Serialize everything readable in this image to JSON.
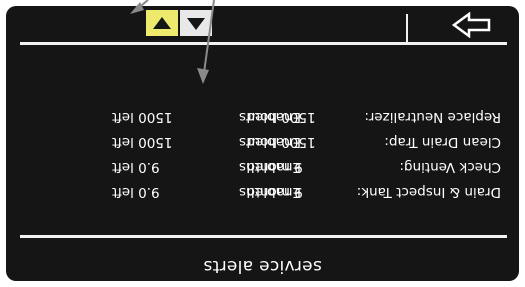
{
  "title": "service alerts",
  "alerts": [
    {
      "name": "Drain & Inspect Tank:",
      "status": "Enabled",
      "limit": "9 months",
      "remaining": "9.0 left"
    },
    {
      "name": "Check Venting:",
      "status": "Enabled",
      "limit": "9 months",
      "remaining": "9.0 left"
    },
    {
      "name": "Clean Drain Trap:",
      "status": "Enabled",
      "limit": "1500 hours",
      "remaining": "1500 left"
    },
    {
      "name": "Replace Neutralizer:",
      "status": "Enabled",
      "limit": "1500 hours",
      "remaining": "1500 left"
    }
  ],
  "icons": {
    "scroll_down": "triangle-down-icon",
    "scroll_up": "triangle-up-icon",
    "next": "outline-right-arrow-icon",
    "annotation": "callout-pointer-icon"
  },
  "colors": {
    "screen_bg": "#151515",
    "text": "#ffffff",
    "selected_button": "#eeea6d",
    "button": "#e8e8e8",
    "callout_line": "#8a8a8a"
  }
}
